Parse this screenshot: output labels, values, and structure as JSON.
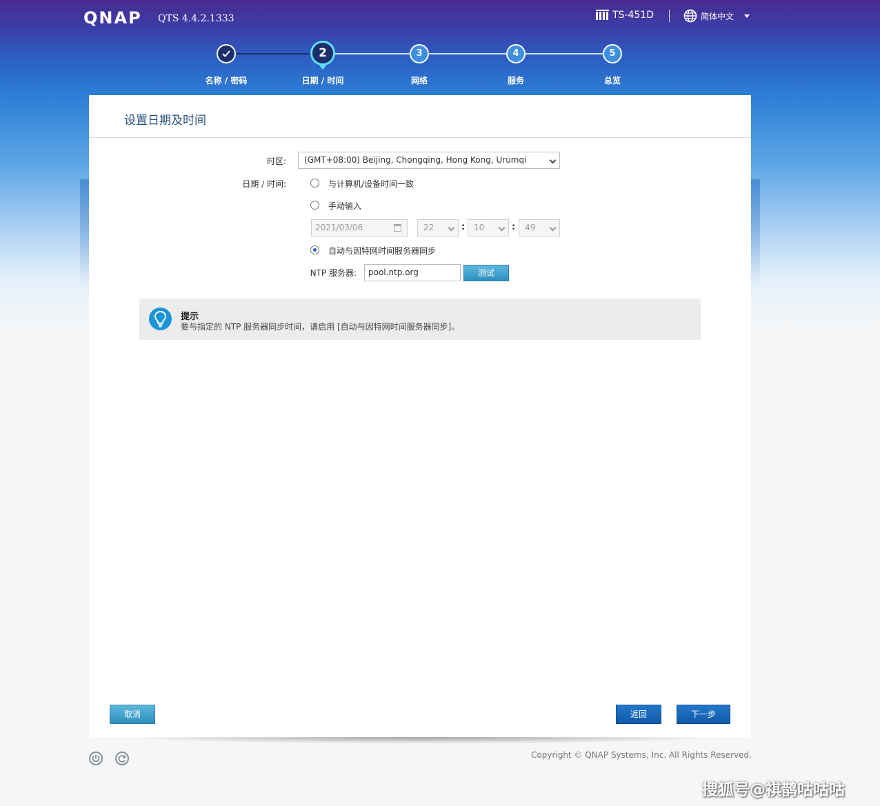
{
  "header": {
    "logo": "QNAP",
    "version": "QTS 4.4.2.1333",
    "device": "TS-451D",
    "language": "简体中文"
  },
  "steps": [
    {
      "num": "",
      "label": "名称 / 密码",
      "state": "done"
    },
    {
      "num": "2",
      "label": "日期 / 时间",
      "state": "active"
    },
    {
      "num": "3",
      "label": "网络",
      "state": "pending"
    },
    {
      "num": "4",
      "label": "服务",
      "state": "pending"
    },
    {
      "num": "5",
      "label": "总览",
      "state": "pending"
    }
  ],
  "panel": {
    "title": "设置日期及时间",
    "timezone_label": "时区:",
    "timezone_value": "(GMT+08:00) Beijing, Chongqing, Hong Kong, Urumqi",
    "datetime_label": "日期 / 时间:",
    "option_sync_pc": "与计算机/设备时间一致",
    "option_manual": "手动输入",
    "date_value": "2021/03/06",
    "hour": "22",
    "minute": "10",
    "second": "49",
    "option_ntp": "自动与因特网时间服务器同步",
    "selected_option": "ntp",
    "ntp_label": "NTP 服务器:",
    "ntp_value": "pool.ntp.org",
    "test_button": "测试"
  },
  "tip": {
    "title": "提示",
    "text": "要与指定的 NTP 服务器同步时间，请启用 [自动与因特网时间服务器同步]。"
  },
  "buttons": {
    "cancel": "取消",
    "back": "返回",
    "next": "下一步"
  },
  "footer": {
    "copyright": "Copyright © QNAP Systems, Inc. All Rights Reserved.",
    "watermark": "搜狐号@祺鹊咕咕咕"
  },
  "colors": {
    "accent": "#1a2f6b",
    "active_ring": "#5fe0ef",
    "button_primary": "#1565b8",
    "button_secondary": "#3fa4d0"
  }
}
